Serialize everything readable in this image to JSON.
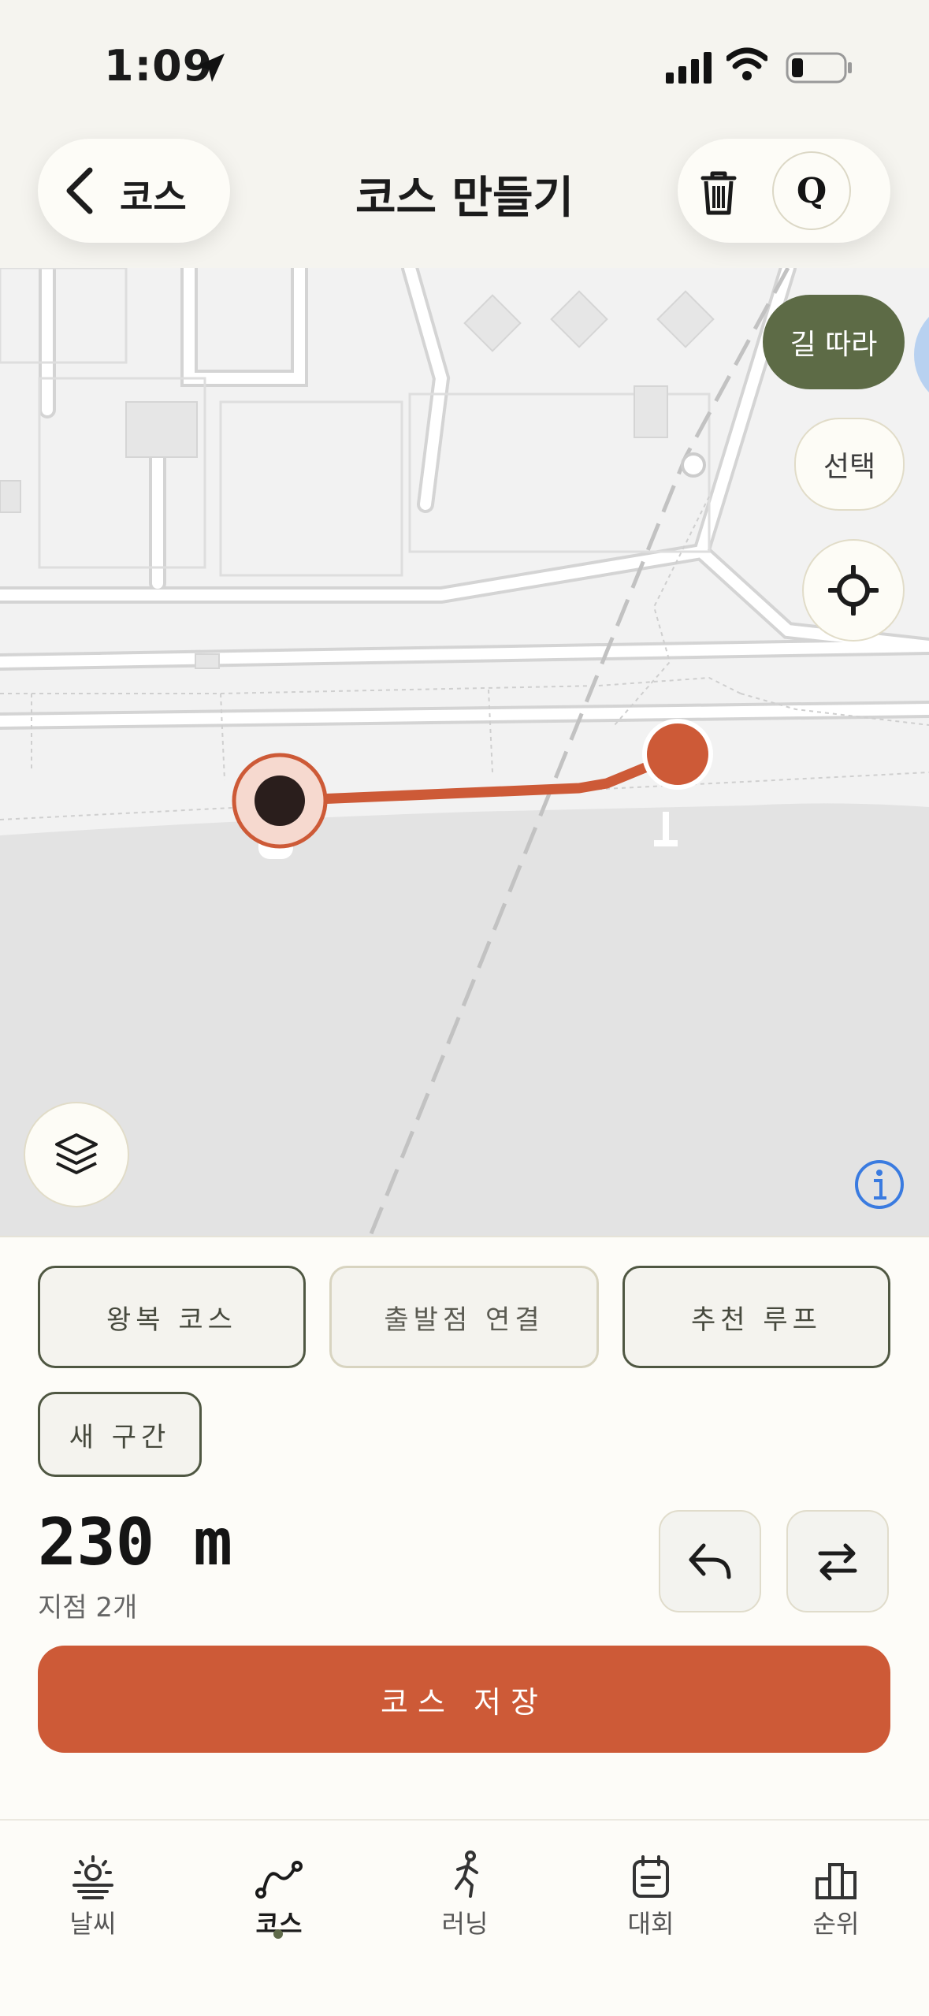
{
  "status_bar": {
    "time": "1:09"
  },
  "header": {
    "back_label": "코스",
    "title": "코스 만들기",
    "search_letter": "Q"
  },
  "map": {
    "route_mode_label": "길 따라",
    "select_label": "선택",
    "route_color": "#cd5a37",
    "start_marker": "start-point",
    "end_marker": "end-point"
  },
  "sheet": {
    "chips": [
      "왕복 코스",
      "출발점 연결",
      "추천 루프",
      "새 구간"
    ],
    "distance": "230 m",
    "points": "지점 2개",
    "save_label": "코스 저장"
  },
  "tabs": [
    {
      "label": "날씨",
      "icon": "sunrise-icon",
      "active": false
    },
    {
      "label": "코스",
      "icon": "route-icon",
      "active": true
    },
    {
      "label": "러닝",
      "icon": "runner-icon",
      "active": false
    },
    {
      "label": "대회",
      "icon": "calendar-icon",
      "active": false
    },
    {
      "label": "순위",
      "icon": "podium-icon",
      "active": false
    }
  ],
  "colors": {
    "accent": "#cd5a37",
    "active_green": "#5d6b46",
    "background": "#fdfcf8"
  }
}
